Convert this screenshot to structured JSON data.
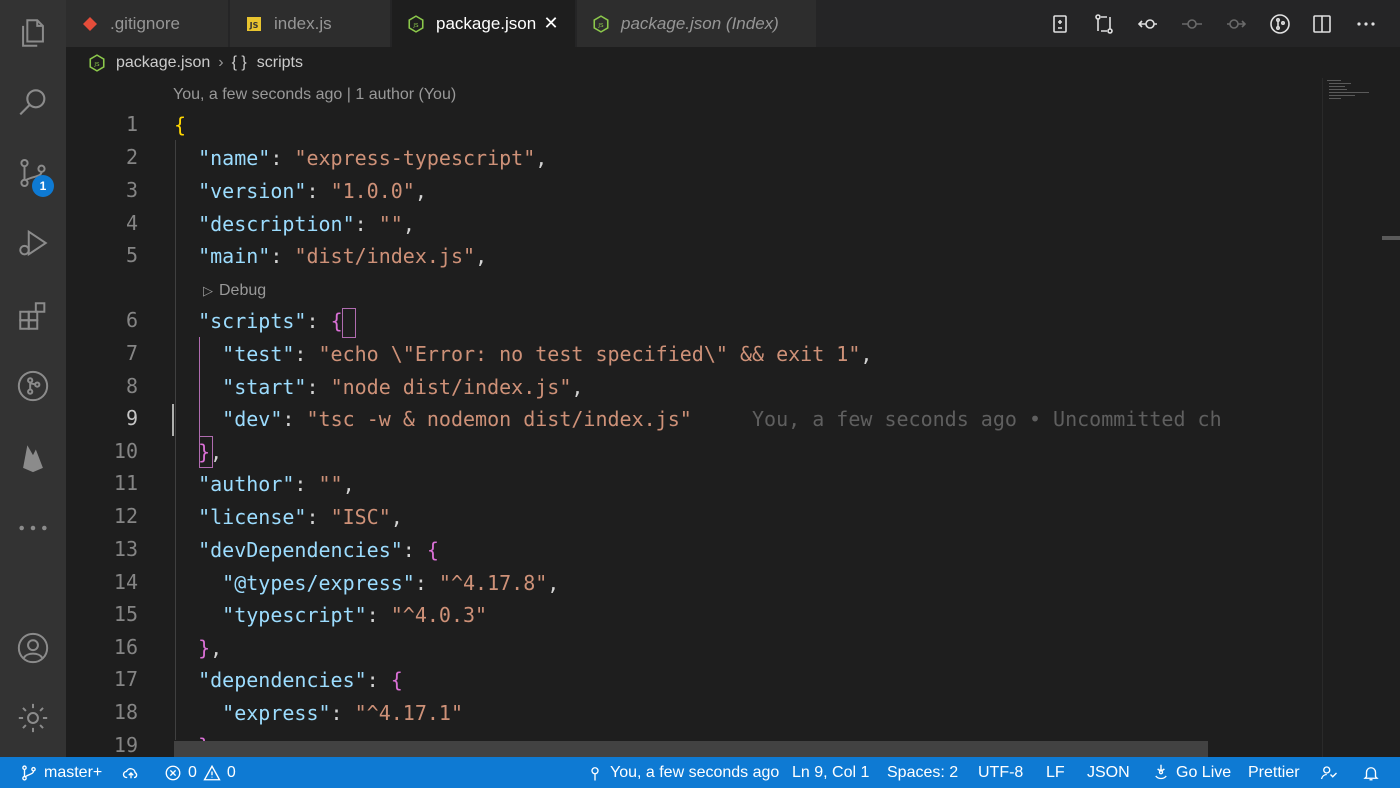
{
  "tabs": [
    {
      "label": ".gitignore",
      "icon": "git-icon"
    },
    {
      "label": "index.js",
      "icon": "js-icon"
    },
    {
      "label": "package.json",
      "icon": "nodejs-icon",
      "active": true
    },
    {
      "label": "package.json (Index)",
      "icon": "nodejs-icon"
    }
  ],
  "breadcrumb": {
    "file": "package.json",
    "symbol_icon": "{ }",
    "symbol": "scripts"
  },
  "codelens": {
    "blame": "You, a few seconds ago | 1 author (You)",
    "debug": "Debug"
  },
  "line_numbers": [
    "1",
    "2",
    "3",
    "4",
    "5",
    "6",
    "7",
    "8",
    "9",
    "10",
    "11",
    "12",
    "13",
    "14",
    "15",
    "16",
    "17",
    "18",
    "19"
  ],
  "code": {
    "l1": "{",
    "l2_key": "\"name\"",
    "l2_val": "\"express-typescript\"",
    "l3_key": "\"version\"",
    "l3_val": "\"1.0.0\"",
    "l4_key": "\"description\"",
    "l4_val": "\"\"",
    "l5_key": "\"main\"",
    "l5_val": "\"dist/index.js\"",
    "l6_key": "\"scripts\"",
    "l6_brace": "{",
    "l7_key": "\"test\"",
    "l7_val": "\"echo \\\"Error: no test specified\\\" && exit 1\"",
    "l8_key": "\"start\"",
    "l8_val": "\"node dist/index.js\"",
    "l9_key": "\"dev\"",
    "l9_val": "\"tsc -w & nodemon dist/index.js\"",
    "l9_blame": "You, a few seconds ago • Uncommitted ch",
    "l10_brace": "}",
    "l11_key": "\"author\"",
    "l11_val": "\"\"",
    "l12_key": "\"license\"",
    "l12_val": "\"ISC\"",
    "l13_key": "\"devDependencies\"",
    "l13_brace": "{",
    "l14_key": "\"@types/express\"",
    "l14_val": "\"^4.17.8\"",
    "l15_key": "\"typescript\"",
    "l15_val": "\"^4.0.3\"",
    "l16_brace": "}",
    "l17_key": "\"dependencies\"",
    "l17_brace": "{",
    "l18_key": "\"express\"",
    "l18_val": "\"^4.17.1\"",
    "l19_brace": "}"
  },
  "activity_badge": "1",
  "status": {
    "branch": "master+",
    "errors": "0",
    "warnings": "0",
    "blame": "You, a few seconds ago",
    "position": "Ln 9, Col 1",
    "spaces": "Spaces: 2",
    "encoding": "UTF-8",
    "eol": "LF",
    "language": "JSON",
    "golive": "Go Live",
    "prettier": "Prettier"
  },
  "colors": {
    "statusbar": "#0e7ad3",
    "activitybar": "#333333",
    "editor": "#1e1e1e",
    "key": "#9cdcfe",
    "string": "#ce9178"
  }
}
